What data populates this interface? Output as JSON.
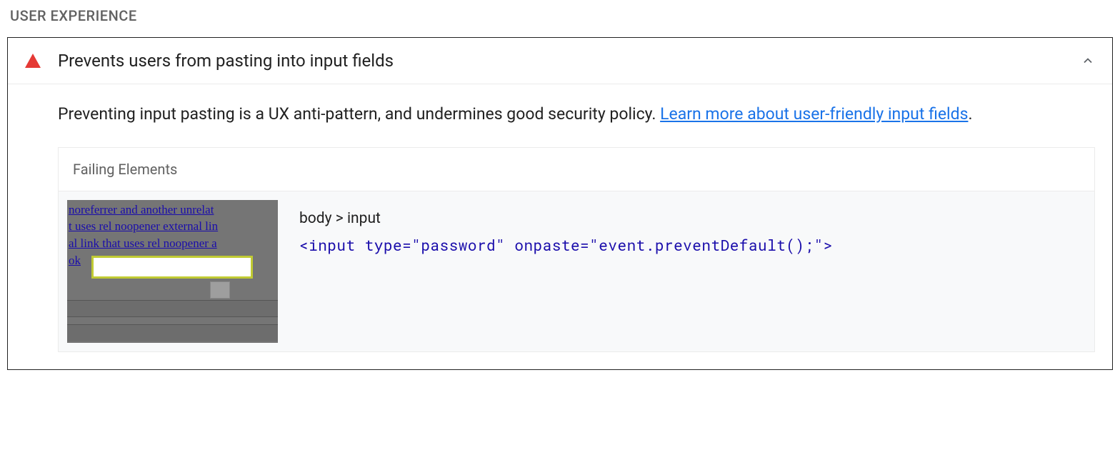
{
  "section": {
    "label": "USER EXPERIENCE"
  },
  "audit": {
    "title": "Prevents users from pasting into input fields",
    "descriptionPrefix": "Preventing input pasting is a UX anti-pattern, and undermines good security policy. ",
    "linkText": "Learn more about user-friendly input fields",
    "descriptionSuffix": "."
  },
  "failing": {
    "header": "Failing Elements",
    "thumbnail": {
      "line1": "  noreferrer and another unrelat",
      "line2": "t uses rel noopener external lin",
      "line3": "al link that uses rel noopener a",
      "line4": "  ok"
    },
    "element": {
      "selector": "body > input",
      "snippet": "<input type=\"password\" onpaste=\"event.preventDefault();\">"
    }
  }
}
